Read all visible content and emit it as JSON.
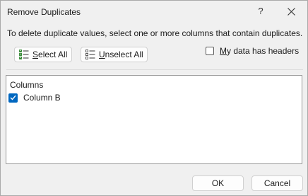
{
  "window": {
    "title": "Remove Duplicates",
    "help_glyph": "?",
    "close_icon": "close-icon"
  },
  "instructions": "To delete duplicate values, select one or more columns that contain duplicates.",
  "buttons": {
    "select_all": {
      "accel": "S",
      "rest": "elect All",
      "icon": "checklist-icon"
    },
    "unselect_all": {
      "accel": "U",
      "rest": "nselect All",
      "icon": "unchecked-list-icon"
    },
    "ok": "OK",
    "cancel": "Cancel"
  },
  "headers_option": {
    "accel": "M",
    "rest": "y data has headers",
    "checked": false
  },
  "columns_list": {
    "header": "Columns",
    "items": [
      {
        "label": "Column B",
        "checked": true
      }
    ]
  },
  "colors": {
    "accent": "#0067c0"
  }
}
